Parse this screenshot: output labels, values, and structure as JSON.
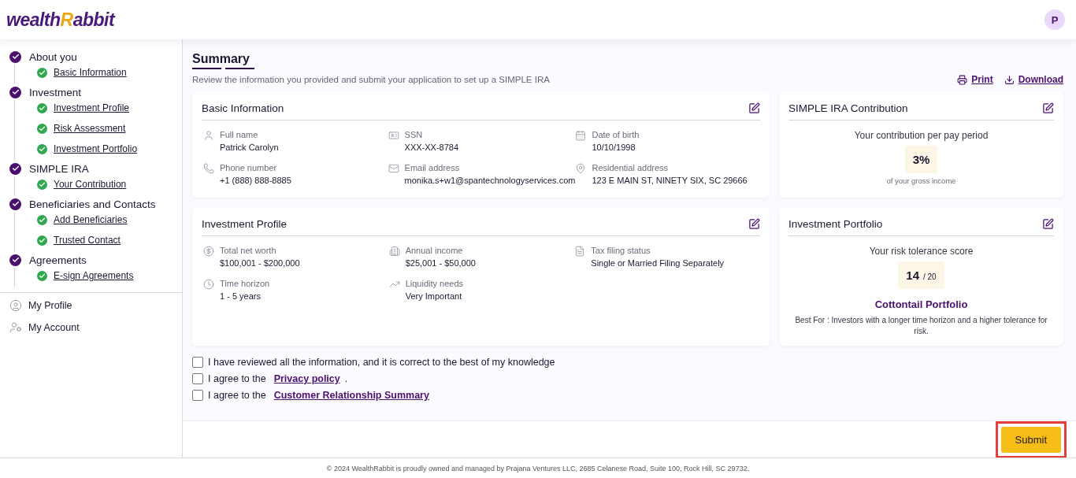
{
  "header": {
    "logo": {
      "before": "wealth",
      "accent": "R",
      "after": "abbit"
    },
    "avatar": "P"
  },
  "sidebar": {
    "steps": [
      {
        "label": "About you",
        "done": true,
        "children": [
          {
            "label": "Basic Information",
            "done": true
          }
        ]
      },
      {
        "label": "Investment",
        "done": true,
        "children": [
          {
            "label": "Investment Profile",
            "done": true
          },
          {
            "label": "Risk Assessment",
            "done": true
          },
          {
            "label": "Investment Portfolio",
            "done": true
          }
        ]
      },
      {
        "label": "SIMPLE IRA",
        "done": true,
        "children": [
          {
            "label": "Your Contribution",
            "done": true
          }
        ]
      },
      {
        "label": "Beneficiaries and Contacts",
        "done": true,
        "children": [
          {
            "label": "Add Beneficiaries",
            "done": true
          },
          {
            "label": "Trusted Contact",
            "done": true
          }
        ]
      },
      {
        "label": "Agreements",
        "done": true,
        "children": [
          {
            "label": "E-sign Agreements",
            "done": true
          }
        ]
      }
    ],
    "links": [
      "My Profile",
      "My Account"
    ]
  },
  "summary": {
    "title": "Summary",
    "subtitle": "Review the information you provided and submit your application to set up a SIMPLE IRA",
    "actions": [
      "Print",
      "Download"
    ]
  },
  "basic_information": {
    "title": "Basic Information",
    "fields": [
      {
        "label": "Full name",
        "value": "Patrick Carolyn"
      },
      {
        "label": "SSN",
        "value": "XXX-XX-8784"
      },
      {
        "label": "Date of birth",
        "value": "10/10/1998"
      },
      {
        "label": "Phone number",
        "value": "+1 (888) 888-8885"
      },
      {
        "label": "Email address",
        "value": "monika.s+w1@spantechnologyservices.com"
      },
      {
        "label": "Residential address",
        "value": "123 E MAIN ST, NINETY SIX, SC 29666"
      }
    ]
  },
  "investment_profile": {
    "title": "Investment Profile",
    "fields": [
      {
        "label": "Total net worth",
        "value": "$100,001 - $200,000"
      },
      {
        "label": "Annual income",
        "value": "$25,001 - $50,000"
      },
      {
        "label": "Tax filing status",
        "value": "Single or Married Filing Separately"
      },
      {
        "label": "Time horizon",
        "value": "1 - 5 years"
      },
      {
        "label": "Liquidity needs",
        "value": "Very Important"
      }
    ]
  },
  "contribution": {
    "title": "SIMPLE IRA Contribution",
    "caption": "Your contribution per pay period",
    "value": "3%",
    "note": "of your gross income"
  },
  "portfolio": {
    "title": "Investment Portfolio",
    "caption": "Your risk tolerance score",
    "score": "14",
    "out_of": "/ 20",
    "name": "Cottontail Portfolio",
    "description": "Best For : Investors with a longer time horizon and a higher tolerance for risk."
  },
  "agreements": [
    {
      "text": "I have reviewed all the information, and it is correct to the best of my knowledge",
      "checked": false
    },
    {
      "text": "I agree to the ",
      "link": "Privacy policy",
      "after": ".",
      "checked": false
    },
    {
      "text": "I agree to the ",
      "link": "Customer Relationship Summary",
      "checked": false
    }
  ],
  "submit": {
    "label": "Submit",
    "highlighted": true
  },
  "footer": "© 2024 WealthRabbit is proudly owned and managed by Prajana Ventures LLC, 2685 Celanese Road, Suite 100, Rock Hill, SC 29732."
}
